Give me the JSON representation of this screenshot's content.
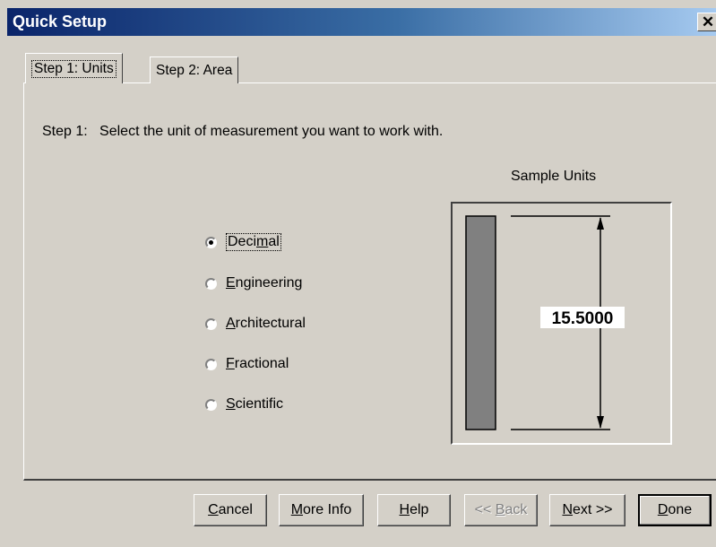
{
  "window": {
    "title": "Quick Setup",
    "close_glyph": "✕"
  },
  "tabs": [
    {
      "label": "Step 1: Units",
      "active": true
    },
    {
      "label": "Step 2: Area",
      "active": false
    }
  ],
  "instruction": "Step 1:   Select the unit of measurement you want to work with.",
  "unit_options": {
    "selected": "Decimal",
    "items": [
      {
        "pre": "Deci",
        "mn": "m",
        "post": "al",
        "checked": true
      },
      {
        "pre": "",
        "mn": "E",
        "post": "ngineering",
        "checked": false
      },
      {
        "pre": "",
        "mn": "A",
        "post": "rchitectural",
        "checked": false
      },
      {
        "pre": "",
        "mn": "F",
        "post": "ractional",
        "checked": false
      },
      {
        "pre": "",
        "mn": "S",
        "post": "cientific",
        "checked": false
      }
    ]
  },
  "sample": {
    "title": "Sample Units",
    "value": "15.5000"
  },
  "buttons": {
    "cancel": {
      "pre": "",
      "mn": "C",
      "post": "ancel"
    },
    "more_info": {
      "pre": "",
      "mn": "M",
      "post": "ore Info"
    },
    "help": {
      "pre": "",
      "mn": "H",
      "post": "elp"
    },
    "back": {
      "pre": "<< ",
      "mn": "B",
      "post": "ack"
    },
    "next": {
      "pre": "",
      "mn": "N",
      "post": "ext >>"
    },
    "done": {
      "pre": "",
      "mn": "D",
      "post": "one"
    }
  },
  "colors": {
    "title_start": "#0a246a",
    "title_end": "#a6caf0",
    "face": "#d4d0c8",
    "sample_bar": "#808080"
  }
}
